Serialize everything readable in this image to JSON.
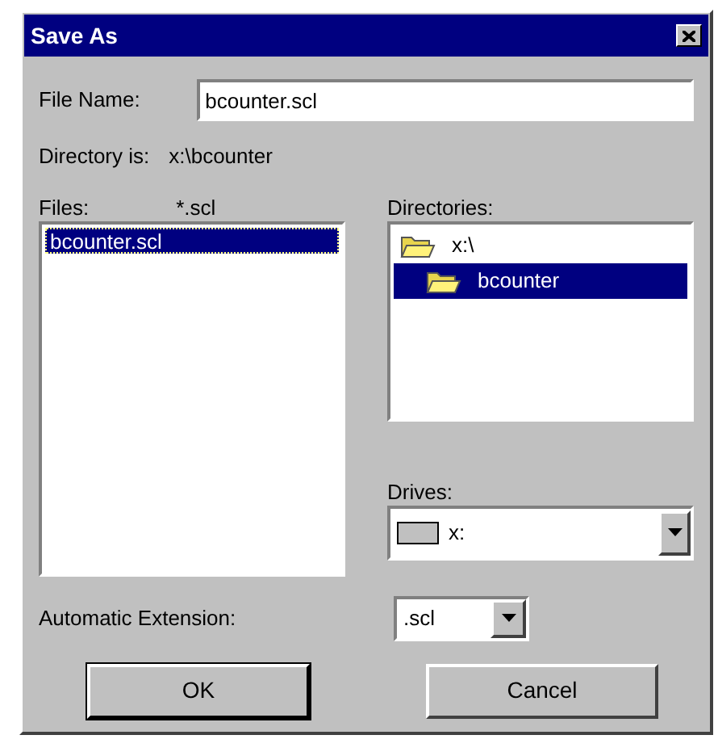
{
  "window": {
    "title": "Save As"
  },
  "file_name": {
    "label": "File Name:",
    "value": "bcounter.scl"
  },
  "directory": {
    "label": "Directory is:",
    "value": "x:\\bcounter"
  },
  "files": {
    "label": "Files:",
    "filter": "*.scl",
    "items": [
      {
        "name": "bcounter.scl",
        "selected": true
      }
    ]
  },
  "directories": {
    "label": "Directories:",
    "items": [
      {
        "name": "x:\\",
        "selected": false,
        "children": [
          {
            "name": "bcounter",
            "selected": true
          }
        ]
      }
    ]
  },
  "drives": {
    "label": "Drives:",
    "value": "x:"
  },
  "extension": {
    "label": "Automatic Extension:",
    "value": ".scl"
  },
  "buttons": [
    {
      "label": "OK",
      "default": true
    },
    {
      "label": "Cancel",
      "default": false
    }
  ]
}
